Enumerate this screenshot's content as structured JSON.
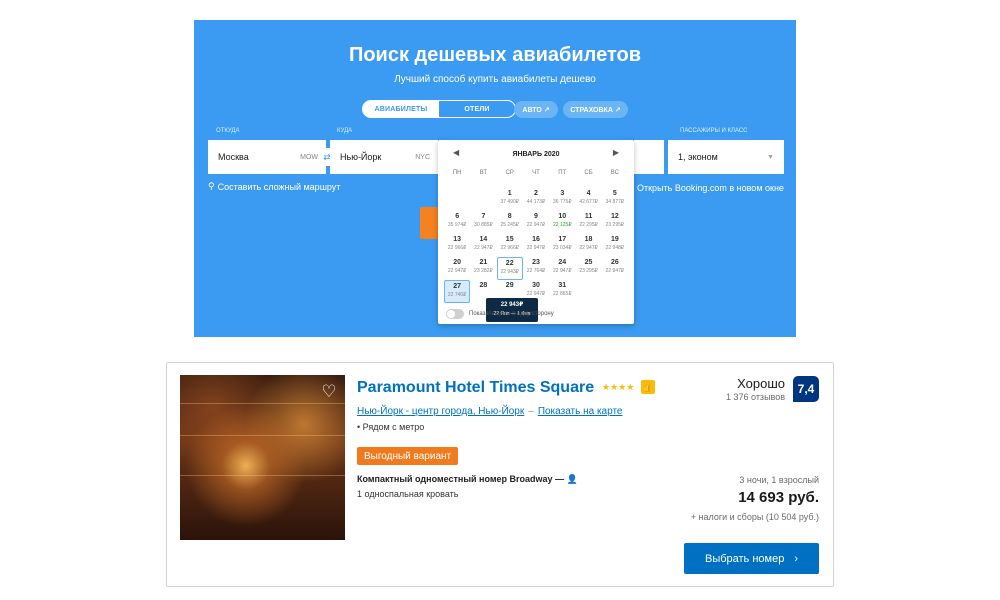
{
  "search": {
    "title": "Поиск дешевых авиабилетов",
    "subtitle": "Лучший способ купить авиабилеты дешево",
    "tabs": [
      {
        "label": "Авиабилеты",
        "active": true
      },
      {
        "label": "Отели",
        "active": false
      }
    ],
    "pills": [
      {
        "label": "АВТО ↗"
      },
      {
        "label": "СТРАХОВКА ↗"
      }
    ],
    "from_label": "ОТКУДА",
    "from_value": "Москва",
    "from_code": "MOW",
    "to_label": "КУДА",
    "to_value": "Нью-Йорк",
    "to_code": "NYC",
    "passengers_label": "ПАССАЖИРЫ И КЛАСС",
    "passengers_value": "1, эконом",
    "complex_route": "Составить сложный маршрут",
    "booking_link": "Открыть Booking.com в новом окне",
    "accent_color": "#3b9bf2",
    "search_button_color": "#f58220"
  },
  "calendar": {
    "month": "ЯНВАРЬ 2020",
    "weekdays": [
      "ПН",
      "ВТ",
      "СР",
      "ЧТ",
      "ПТ",
      "СБ",
      "ВС"
    ],
    "weeks": [
      [
        null,
        null,
        {
          "day": "1",
          "price": "37 490₽"
        },
        {
          "day": "2",
          "price": "44 173₽"
        },
        {
          "day": "3",
          "price": "36 775₽"
        },
        {
          "day": "4",
          "price": "42 677₽"
        },
        {
          "day": "5",
          "price": "34 877₽"
        }
      ],
      [
        {
          "day": "6",
          "price": "35 974₽"
        },
        {
          "day": "7",
          "price": "30 885₽"
        },
        {
          "day": "8",
          "price": "25 245₽"
        },
        {
          "day": "9",
          "price": "22 947₽"
        },
        {
          "day": "10",
          "price": "22 125₽",
          "cheapest": true
        },
        {
          "day": "11",
          "price": "22 295₽"
        },
        {
          "day": "12",
          "price": "23 295₽"
        }
      ],
      [
        {
          "day": "13",
          "price": "22 966₽"
        },
        {
          "day": "14",
          "price": "22 947₽"
        },
        {
          "day": "15",
          "price": "22 966₽"
        },
        {
          "day": "16",
          "price": "22 947₽"
        },
        {
          "day": "17",
          "price": "23 034₽"
        },
        {
          "day": "18",
          "price": "22 947₽"
        },
        {
          "day": "19",
          "price": "22 948₽"
        }
      ],
      [
        {
          "day": "20",
          "price": "22 947₽"
        },
        {
          "day": "21",
          "price": "23 282₽"
        },
        {
          "day": "22",
          "price": "22 943₽",
          "selected": true
        },
        {
          "day": "23",
          "price": "22 764₽"
        },
        {
          "day": "24",
          "price": "22 947₽"
        },
        {
          "day": "25",
          "price": "23 295₽"
        },
        {
          "day": "26",
          "price": "22 947₽"
        }
      ],
      [
        {
          "day": "27",
          "price": "22 740₽",
          "range_end": true
        },
        {
          "day": "28",
          "price": ""
        },
        {
          "day": "29",
          "price": ""
        },
        {
          "day": "30",
          "price": "22 947₽"
        },
        {
          "day": "31",
          "price": "22 865₽"
        },
        null,
        null
      ]
    ],
    "tooltip_price": "22 943₽",
    "tooltip_dates": "22 Янв — 1 Фев",
    "one_way_toggle": "Показать цены в одну сторону"
  },
  "hotel": {
    "name": "Paramount Hotel Times Square",
    "stars": "★★★★",
    "location": "Нью-Йорк - центр города, Нью-Йорк",
    "map_link": "Показать на карте",
    "metro": "• Рядом с метро",
    "deal_badge": "Выгодный вариант",
    "room_name": "Компактный одноместный номер Broadway",
    "room_extra": "— ",
    "bed": "1 односпальная кровать",
    "review_word": "Хорошо",
    "review_count": "1 376 отзывов",
    "score": "7,4",
    "nights": "3 ночи, 1 взрослый",
    "price": "14 693 руб.",
    "taxes": "+ налоги и сборы (10 504 руб.)",
    "select_button": "Выбрать номер",
    "link_color": "#0071c2",
    "score_color": "#003580",
    "badge_color": "#f07b1f"
  }
}
